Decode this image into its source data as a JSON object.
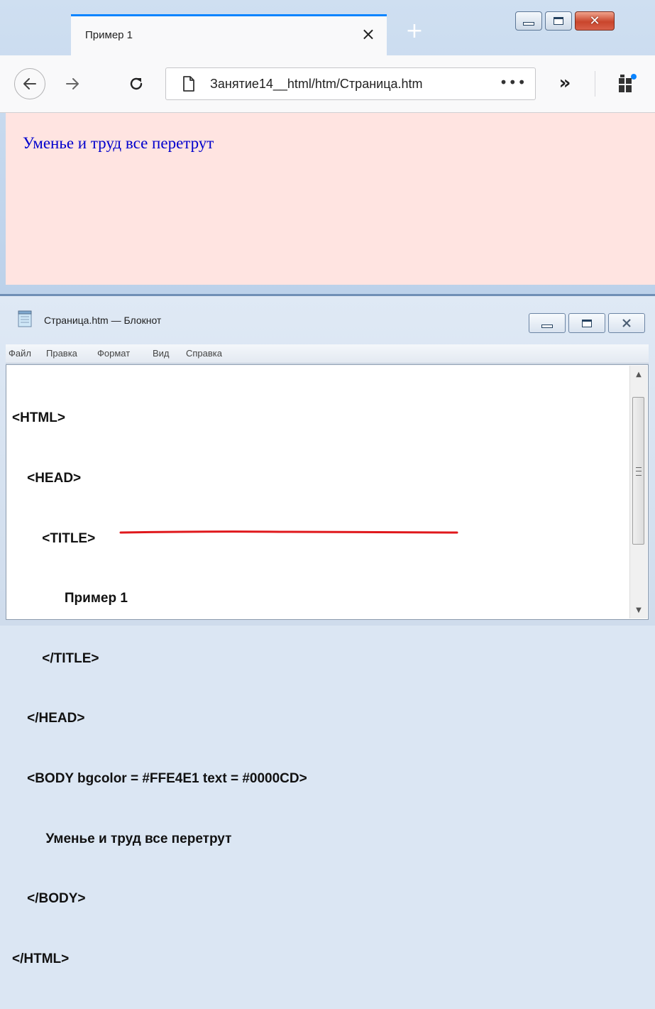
{
  "browser": {
    "tab_title": "Пример 1",
    "tab_close": "×",
    "new_tab": "+",
    "url": "Занятие14__html/htm/Страница.htm",
    "url_more": "•••",
    "overflow": "»",
    "page_text": "Уменье и труд все перетрут",
    "page_bgcolor": "#FFE4E1",
    "page_text_color": "#0000CD"
  },
  "notepad": {
    "title": "Страница.htm — Блокнот",
    "menu": [
      "Файл",
      "Правка",
      "Формат",
      "Вид",
      "Справка"
    ],
    "lines": [
      "<HTML>",
      "    <HEAD>",
      "        <TITLE>",
      "              Пример 1",
      "        </TITLE>",
      "    </HEAD>",
      "    <BODY bgcolor = #FFE4E1 text = #0000CD>",
      "         Уменье и труд все перетрут",
      "    </BODY>",
      "</HTML>"
    ],
    "highlight_color": "#e0181c"
  },
  "icons": {
    "back": "back-arrow-icon",
    "forward": "forward-arrow-icon",
    "reload": "reload-icon",
    "page": "page-icon",
    "extensions": "extensions-icon",
    "notepad": "notepad-icon"
  }
}
